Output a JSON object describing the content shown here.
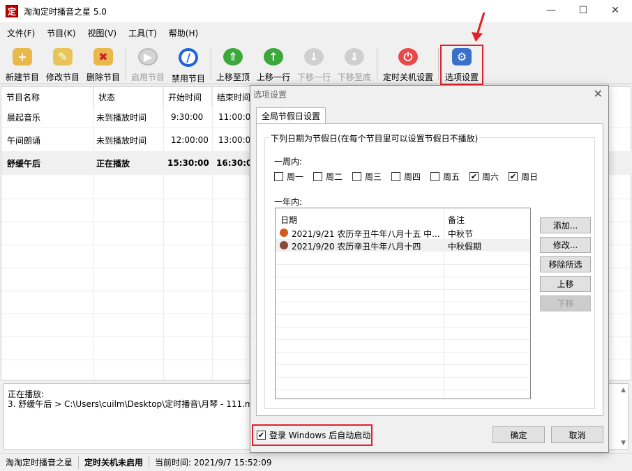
{
  "window": {
    "title": "淘淘定时播音之星 5.0",
    "app_icon_char": "定"
  },
  "menu": [
    "文件(F)",
    "节目(K)",
    "视图(V)",
    "工具(T)",
    "帮助(H)"
  ],
  "toolbar": {
    "new": "新建节目",
    "edit": "修改节目",
    "delete": "删除节目",
    "enable": "启用节目",
    "disable": "禁用节目",
    "move_top": "上移至顶",
    "move_up": "上移一行",
    "move_down": "下移一行",
    "move_bottom": "下移至底",
    "shutdown": "定时关机设置",
    "options": "选项设置"
  },
  "list": {
    "columns": [
      "节目名称",
      "状态",
      "开始时间",
      "结束时间"
    ],
    "rows": [
      {
        "name": "晨起音乐",
        "status": "未到播放时间",
        "start": "9:30:00",
        "end": "11:00:00"
      },
      {
        "name": "午间朗诵",
        "status": "未到播放时间",
        "start": "12:00:00",
        "end": "13:00:00"
      },
      {
        "name": "舒缓午后",
        "status": "正在播放",
        "start": "15:30:00",
        "end": "16:30:00"
      }
    ]
  },
  "now_playing": {
    "label": "正在播放:",
    "line": "3. 舒缓午后 > C:\\Users\\cuilm\\Desktop\\定时播音\\月琴 - 111.mp3"
  },
  "status": {
    "app": "淘淘定时播音之星",
    "shutdown": "定时关机未启用",
    "time": "当前时间: 2021/9/7 15:52:09"
  },
  "dialog": {
    "title": "选项设置",
    "tab": "全局节假日设置",
    "group_title": "下列日期为节假日(在每个节目里可以设置节假日不播放)",
    "week_label": "一周内:",
    "weekdays": [
      {
        "label": "周一",
        "checked": false
      },
      {
        "label": "周二",
        "checked": false
      },
      {
        "label": "周三",
        "checked": false
      },
      {
        "label": "周四",
        "checked": false
      },
      {
        "label": "周五",
        "checked": false
      },
      {
        "label": "周六",
        "checked": true
      },
      {
        "label": "周日",
        "checked": true
      }
    ],
    "year_label": "一年内:",
    "holiday_columns": [
      "日期",
      "备注"
    ],
    "holidays": [
      {
        "date": "2021/9/21 农历辛丑牛年八月十五 中...",
        "note": "中秋节"
      },
      {
        "date": "2021/9/20 农历辛丑牛年八月十四",
        "note": "中秋假期"
      }
    ],
    "buttons": {
      "add": "添加...",
      "edit": "修改...",
      "remove": "移除所选",
      "up": "上移",
      "down": "下移"
    },
    "autostart": {
      "label": "登录 Windows 后自动启动",
      "checked": true
    },
    "ok": "确定",
    "cancel": "取消"
  },
  "colors": {
    "highlight": "#e0202c"
  }
}
